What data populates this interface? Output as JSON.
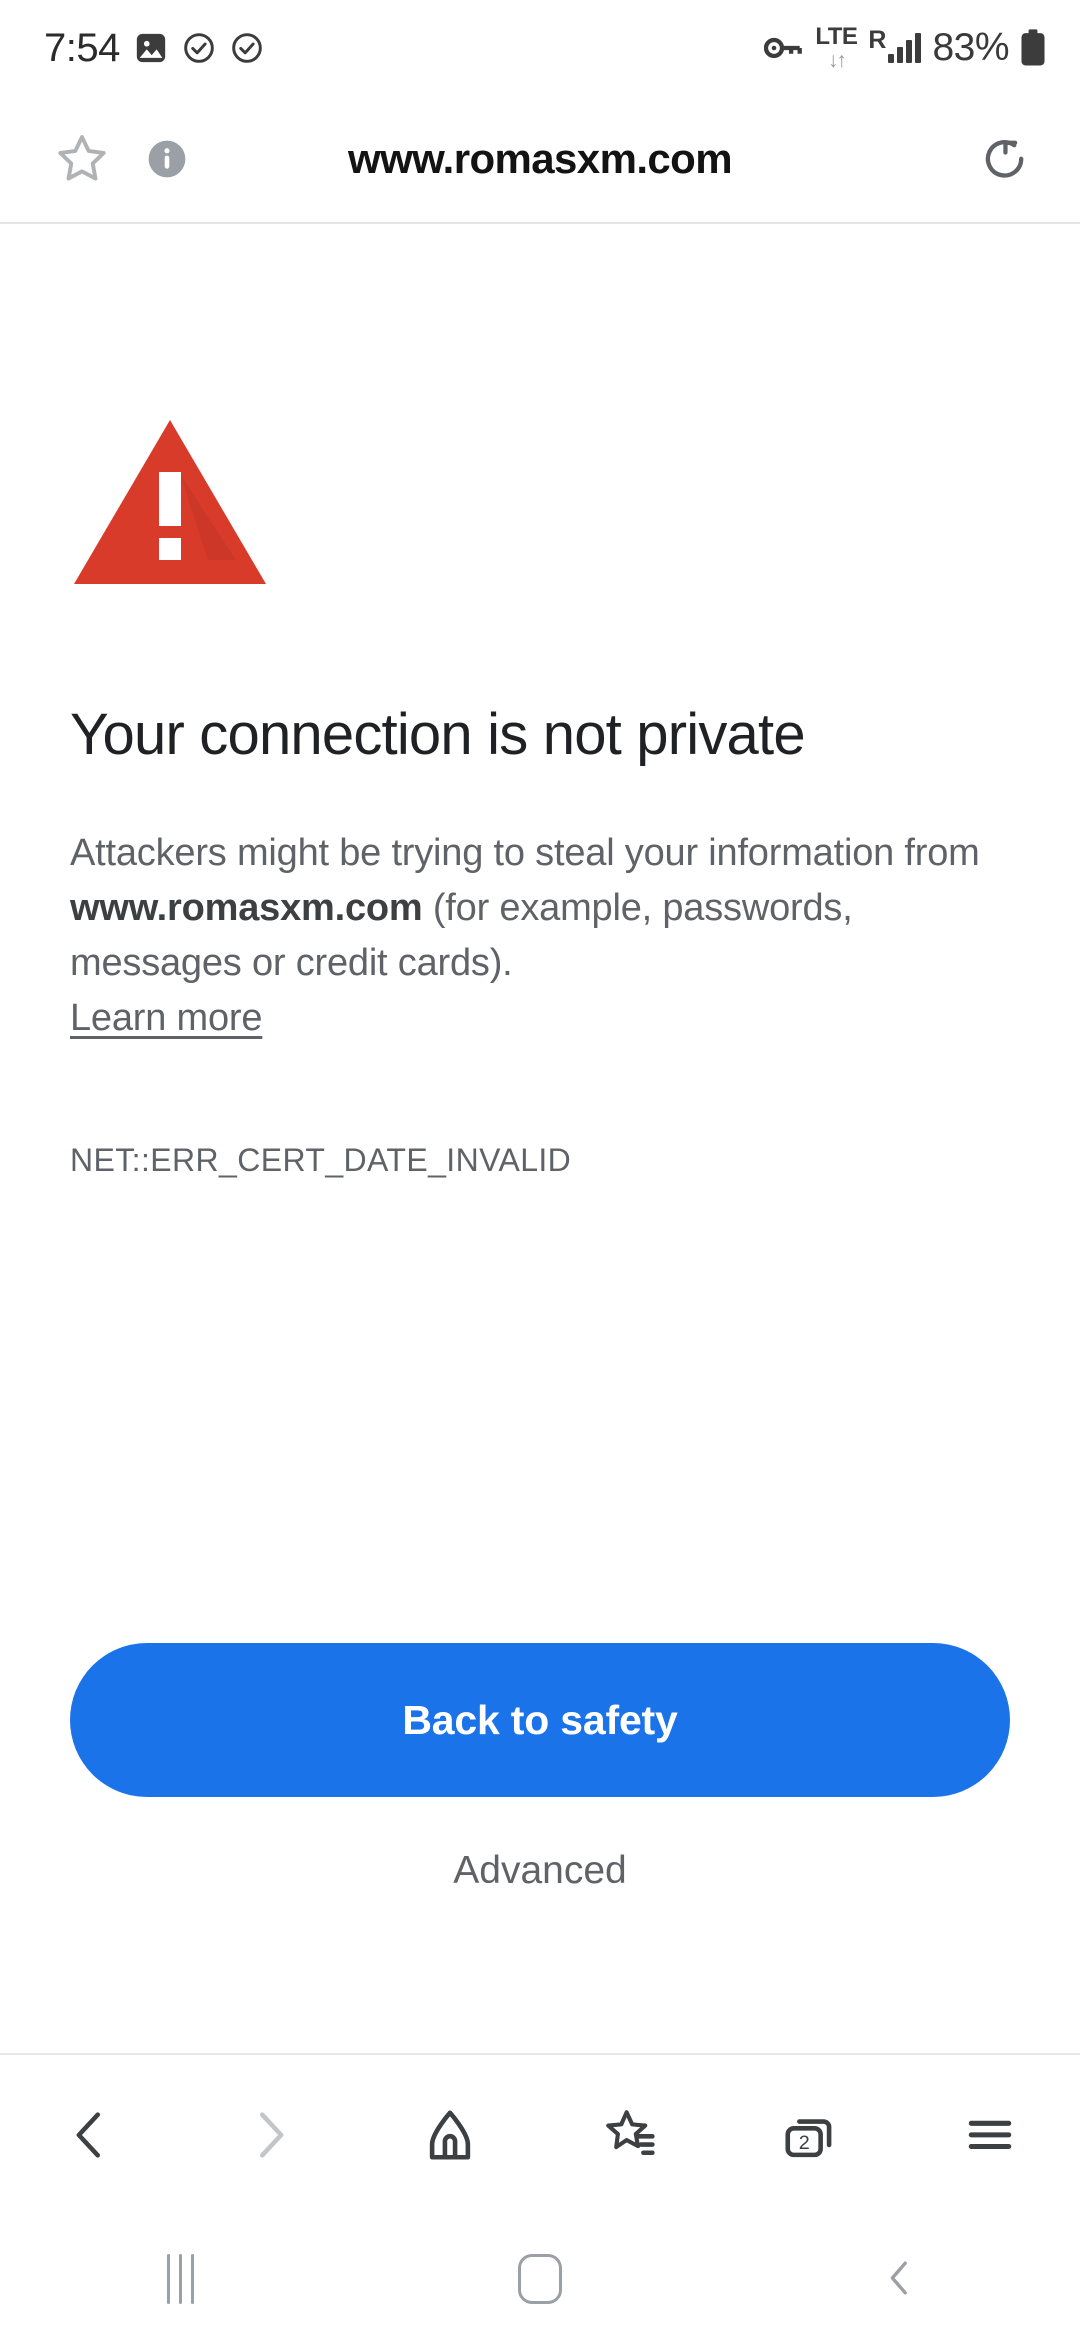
{
  "statusbar": {
    "clock": "7:54",
    "icons_left": [
      "image-icon",
      "check-circle-icon",
      "check-circle-icon"
    ],
    "vpn_key": "key-icon",
    "network_type": "LTE",
    "network_arrows": "↓↑",
    "roaming": "R",
    "signal_bars": 4,
    "battery_percent": "83%",
    "battery_icon": "battery-icon"
  },
  "urlbar": {
    "bookmark_icon": "star-outline-icon",
    "info_icon": "info-circle-icon",
    "url": "www.romasxm.com",
    "reload_icon": "reload-icon"
  },
  "page": {
    "warning_icon": "warning-triangle-icon",
    "title": "Your connection is not private",
    "body_prefix": "Attackers might be trying to steal your information from ",
    "body_domain": "www.romasxm.com",
    "body_suffix": " (for example, passwords, messages or credit cards). ",
    "learn_more": "Learn more",
    "error_code": "NET::ERR_CERT_DATE_INVALID",
    "primary_button": "Back to safety",
    "secondary_button": "Advanced"
  },
  "browser_toolbar": {
    "items": [
      {
        "name": "back",
        "icon": "chevron-left-icon",
        "enabled": true
      },
      {
        "name": "forward",
        "icon": "chevron-right-icon",
        "enabled": false
      },
      {
        "name": "home",
        "icon": "home-icon",
        "enabled": true
      },
      {
        "name": "bookmarks",
        "icon": "star-list-icon",
        "enabled": true
      },
      {
        "name": "tabs",
        "icon": "tabs-icon",
        "enabled": true,
        "count": "2"
      },
      {
        "name": "menu",
        "icon": "hamburger-menu-icon",
        "enabled": true
      }
    ]
  },
  "navbar": {
    "recents": "recents-icon",
    "home": "home-pill-icon",
    "back": "back-chevron-icon"
  },
  "colors": {
    "warning_red": "#d93b2b",
    "primary_blue": "#1a73e8",
    "text_primary": "#202124",
    "text_secondary": "#5f6368",
    "divider": "#e4e6e8",
    "icon_gray": "#9aa0a6"
  }
}
